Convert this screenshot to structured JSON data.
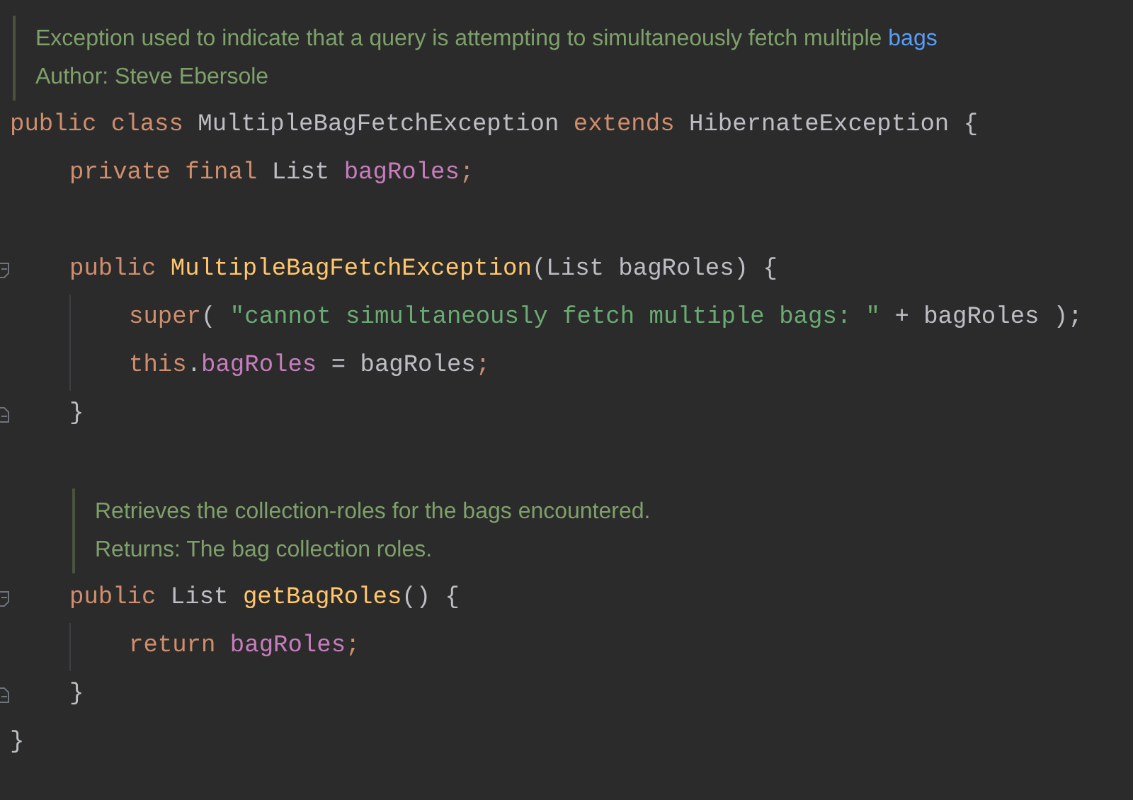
{
  "code": [
    {
      "kind": "doc",
      "lines": [
        {
          "text": "Exception used to indicate that a query is attempting to simultaneously fetch multiple",
          "link": "bags"
        },
        {
          "text": "Author: Steve Ebersole"
        }
      ]
    },
    {
      "kind": "code",
      "fold_start": false,
      "fold_end": false,
      "tokens": [
        {
          "kind": "keyword",
          "text": "public class "
        },
        {
          "kind": "plain",
          "text": "MultipleBagFetchException "
        },
        {
          "kind": "keyword",
          "text": "extends "
        },
        {
          "kind": "plain",
          "text": "HibernateException {"
        }
      ],
      "children": [
        {
          "kind": "code",
          "fold_start": false,
          "fold_end": false,
          "tokens": [
            {
              "kind": "keyword",
              "text": "private final "
            },
            {
              "kind": "plain",
              "text": "List "
            },
            {
              "kind": "field",
              "text": "bagRoles"
            },
            {
              "kind": "keyword",
              "text": ";"
            }
          ]
        },
        {
          "kind": "blank"
        },
        {
          "kind": "code",
          "fold_start": true,
          "fold_end": false,
          "tokens": [
            {
              "kind": "keyword",
              "text": "public "
            },
            {
              "kind": "method",
              "text": "MultipleBagFetchException"
            },
            {
              "kind": "plain",
              "text": "(List bagRoles) {"
            }
          ],
          "children": [
            {
              "kind": "code",
              "fold_start": false,
              "fold_end": false,
              "tokens": [
                {
                  "kind": "keyword",
                  "text": "super"
                },
                {
                  "kind": "plain",
                  "text": "( "
                },
                {
                  "kind": "string",
                  "text": "\"cannot simultaneously fetch multiple bags: \""
                },
                {
                  "kind": "plain",
                  "text": " + bagRoles );"
                }
              ]
            },
            {
              "kind": "code",
              "fold_start": false,
              "fold_end": false,
              "tokens": [
                {
                  "kind": "keyword",
                  "text": "this"
                },
                {
                  "kind": "plain",
                  "text": "."
                },
                {
                  "kind": "field",
                  "text": "bagRoles"
                },
                {
                  "kind": "plain",
                  "text": " = bagRoles"
                },
                {
                  "kind": "keyword",
                  "text": ";"
                }
              ]
            }
          ]
        },
        {
          "kind": "code",
          "fold_start": false,
          "fold_end": true,
          "tokens": [
            {
              "kind": "plain",
              "text": "}"
            }
          ]
        },
        {
          "kind": "blank"
        },
        {
          "kind": "doc",
          "lines": [
            {
              "text": "Retrieves the collection-roles for the bags encountered."
            },
            {
              "text": "Returns: The bag collection roles."
            }
          ]
        },
        {
          "kind": "code",
          "fold_start": true,
          "fold_end": false,
          "tokens": [
            {
              "kind": "keyword",
              "text": "public "
            },
            {
              "kind": "plain",
              "text": "List "
            },
            {
              "kind": "method",
              "text": "getBagRoles"
            },
            {
              "kind": "plain",
              "text": "() {"
            }
          ],
          "children": [
            {
              "kind": "code",
              "fold_start": false,
              "fold_end": false,
              "tokens": [
                {
                  "kind": "keyword",
                  "text": "return "
                },
                {
                  "kind": "field",
                  "text": "bagRoles"
                },
                {
                  "kind": "keyword",
                  "text": ";"
                }
              ]
            }
          ]
        },
        {
          "kind": "code",
          "fold_start": false,
          "fold_end": true,
          "tokens": [
            {
              "kind": "plain",
              "text": "}"
            }
          ]
        }
      ]
    },
    {
      "kind": "code",
      "fold_start": false,
      "fold_end": false,
      "tokens": [
        {
          "kind": "plain",
          "text": "}"
        }
      ]
    }
  ]
}
